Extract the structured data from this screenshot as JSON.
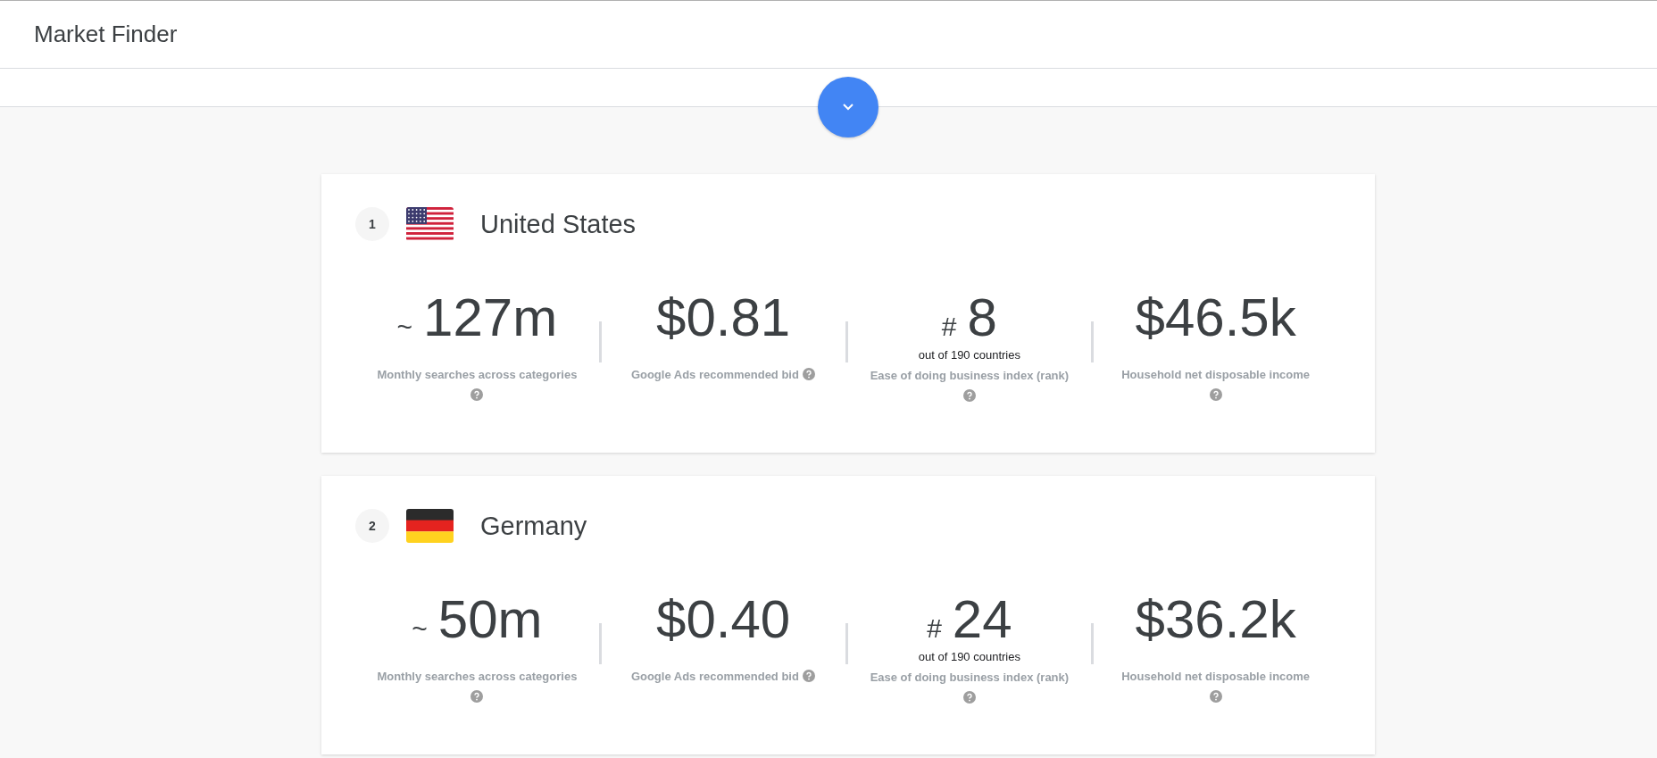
{
  "header": {
    "title": "Market Finder"
  },
  "countries": [
    {
      "rank": "1",
      "flag": {
        "kind": "us"
      },
      "name": "United States",
      "metrics": [
        {
          "prefix": "~",
          "value": "127m",
          "label": "Monthly searches across categories"
        },
        {
          "value": "$0.81",
          "label": "Google Ads recommended bid"
        },
        {
          "prefix": "#",
          "value": "8",
          "note": "out of 190 countries",
          "label": "Ease of doing business index (rank)"
        },
        {
          "value": "$46.5k",
          "label": "Household net disposable income"
        }
      ]
    },
    {
      "rank": "2",
      "flag": {
        "kind": "de"
      },
      "name": "Germany",
      "metrics": [
        {
          "prefix": "~",
          "value": "50m",
          "label": "Monthly searches across categories"
        },
        {
          "value": "$0.40",
          "label": "Google Ads recommended bid"
        },
        {
          "prefix": "#",
          "value": "24",
          "note": "out of 190 countries",
          "label": "Ease of doing business index (rank)"
        },
        {
          "value": "$36.2k",
          "label": "Household net disposable income"
        }
      ]
    }
  ]
}
